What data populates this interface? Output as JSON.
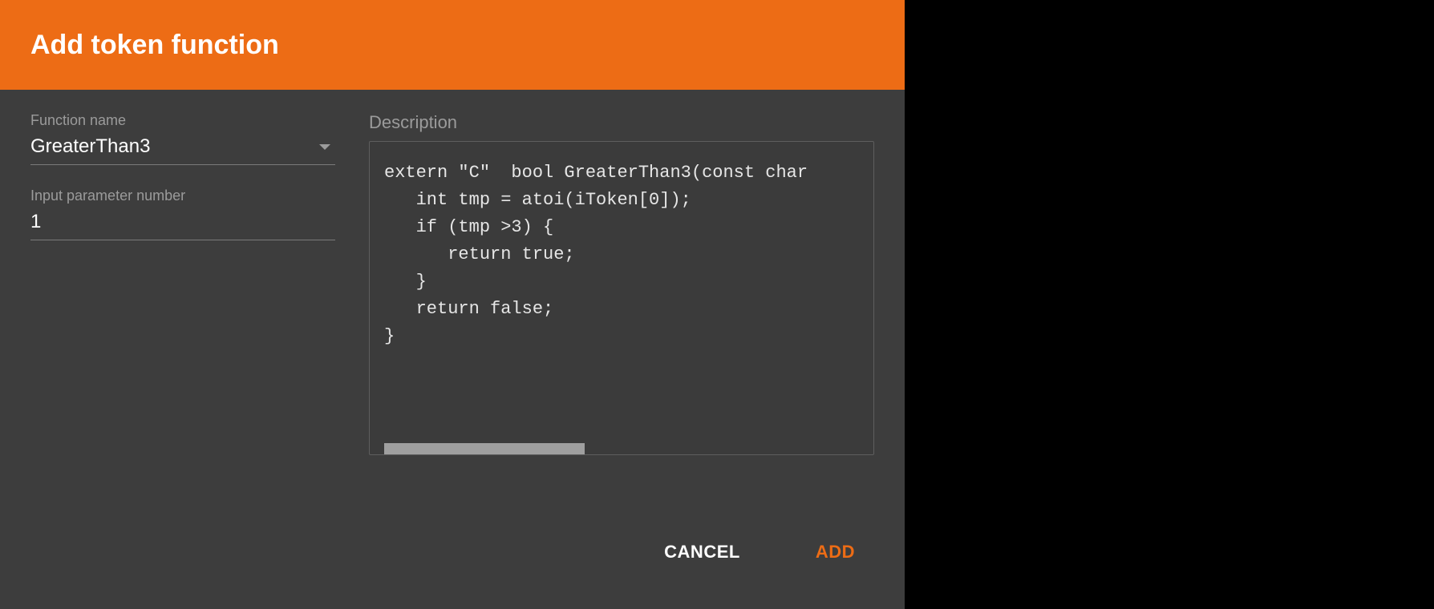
{
  "dialog": {
    "title": "Add token function",
    "fields": {
      "function_name": {
        "label": "Function name",
        "value": "GreaterThan3"
      },
      "input_param_number": {
        "label": "Input parameter number",
        "value": "1"
      }
    },
    "description": {
      "label": "Description",
      "code": "extern \"C\"  bool GreaterThan3(const char\n   int tmp = atoi(iToken[0]);\n   if (tmp >3) {\n      return true;\n   }\n   return false;\n}"
    },
    "buttons": {
      "cancel": "CANCEL",
      "add": "ADD"
    }
  }
}
